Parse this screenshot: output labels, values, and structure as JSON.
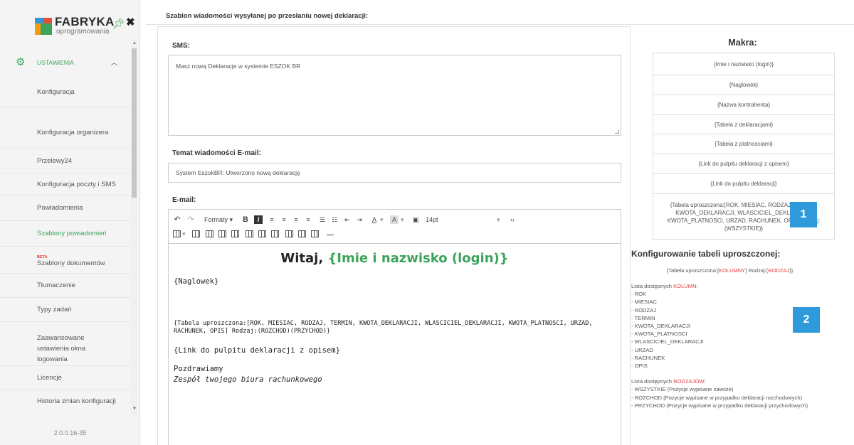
{
  "sidebar": {
    "logo_name": "FABRYKA",
    "logo_sub": "oprogramowania",
    "section": "USTAWIENIA",
    "items": [
      {
        "label": "Konfiguracja"
      },
      {
        "label": "Konfiguracja organizera"
      },
      {
        "label": "Przelewy24"
      },
      {
        "label": "Konfiguracja poczty i SMS"
      },
      {
        "label": "Powiadomienia"
      },
      {
        "label": "Szablony powiadomień"
      },
      {
        "label": "Szablony dokumentów",
        "badge": "BETA"
      },
      {
        "label": "Tłumaczenie"
      },
      {
        "label": "Typy zadań"
      },
      {
        "label": "Zaawansowane ustawienia okna logowania"
      },
      {
        "label": "Licencje"
      },
      {
        "label": "Historia zmian konfiguracji"
      }
    ],
    "version": "2.0.0.16-35",
    "accent_color": "#3ba35a"
  },
  "header": {
    "title": "Szablon wiadomości wysyłanej po przesłaniu nowej deklaracji:"
  },
  "form": {
    "sms_label": "SMS:",
    "sms_value": "Masz nową Deklaracje w systemie ESZOK BR",
    "subject_label": "Temat wiadomości E-mail:",
    "subject_value": "System EszokBR: Utworzono nową deklarację",
    "email_label": "E-mail:",
    "toolbar": {
      "formats_label": "Formaty",
      "font_size": "14pt"
    },
    "email_content": {
      "greeting": "Witaj,",
      "greeting_macro": "{Imie i nazwisko (login)}",
      "line_header": "{Naglowek}",
      "line_table_1": "{Tabela uproszczona:[ROK, MIESIAC, RODZAJ, TERMIN, KWOTA_DEKLARACJI, WLASCICIEL_DEKLARACJI, KWOTA_PLATNOSCI, URZAD,",
      "line_table_2": "RACHUNEK, OPIS] Rodzaj:(ROZCHOD)(PRZYCHOD)}",
      "line_link": "{Link do pulpitu deklaracji z opisem}",
      "regards": "Pozdrawiamy",
      "signature": "Zespół twojego biura rachunkowego"
    }
  },
  "macros": {
    "title": "Makra:",
    "items": [
      "{Imie i nazwisko (login)}",
      "{Naglowek}",
      "{Nazwa kontrahenta}",
      "{Tabela z deklaracjami}",
      "{Tabela z platnosciami}",
      "{Link do pulpitu deklaracji z opisem}",
      "{Link do pulpitu deklaracji}"
    ],
    "table_macro": "{Tabela uproszczona:[ROK, MIESIAC, RODZAJ, TERMIN, KWOTA_DEKLARACJI, WLASCICIEL_DEKLARACJI, KWOTA_PLATNOSCI, URZAD, RACHUNEK, OPIS] Rodzaj:(WSZYSTKIE)}"
  },
  "badges": {
    "one": "1",
    "two": "2",
    "color": "#2e9ad9"
  },
  "config": {
    "title": "Konfigurowanie tabeli uproszczonej:",
    "syntax_prefix": "{Tabela uproszczona:[",
    "syntax_columns": "KOLUMNY",
    "syntax_middle": "] Rodzaj:(",
    "syntax_kinds": "RODZAJ",
    "syntax_suffix": ")}",
    "columns_intro": "Lista dostępnych ",
    "columns_word": "KOLUMN",
    "columns": [
      "- ROK",
      "- MIESIAC",
      "- RODZAJ",
      "- TERMIN",
      "- KWOTA_DEKLARACJI",
      "- KWOTA_PLATNOSCI",
      "- WLASCICIEL_DEKLARACJI",
      "- URZAD",
      "- RACHUNEK",
      "- OPIS"
    ],
    "kinds_intro": "Lista dostępnych ",
    "kinds_word": "RODZAJÓW",
    "kinds": [
      "- WSZYSTKIE (Pozycje wypisane zawsze)",
      "- ROZCHOD (Pozycje wypisane w przypadku deklaracji rozchodowych)",
      "- PRZYCHOD (Pozycje wypisane w przypadku deklaracji przychodowych)"
    ]
  }
}
